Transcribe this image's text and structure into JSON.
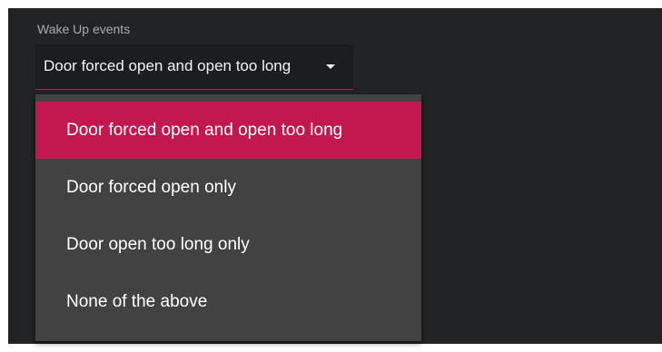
{
  "field": {
    "label": "Wake Up events",
    "value": "Door forced open and open too long"
  },
  "menu": {
    "options": [
      {
        "label": "Door forced open and open too long",
        "selected": true
      },
      {
        "label": "Door forced open only",
        "selected": false
      },
      {
        "label": "Door open too long only",
        "selected": false
      },
      {
        "label": "None of the above",
        "selected": false
      }
    ]
  },
  "colors": {
    "panel_background": "#212325",
    "menu_background": "#424242",
    "accent": "#c2184f"
  },
  "icons": {
    "dropdown": "caret-down-icon"
  }
}
